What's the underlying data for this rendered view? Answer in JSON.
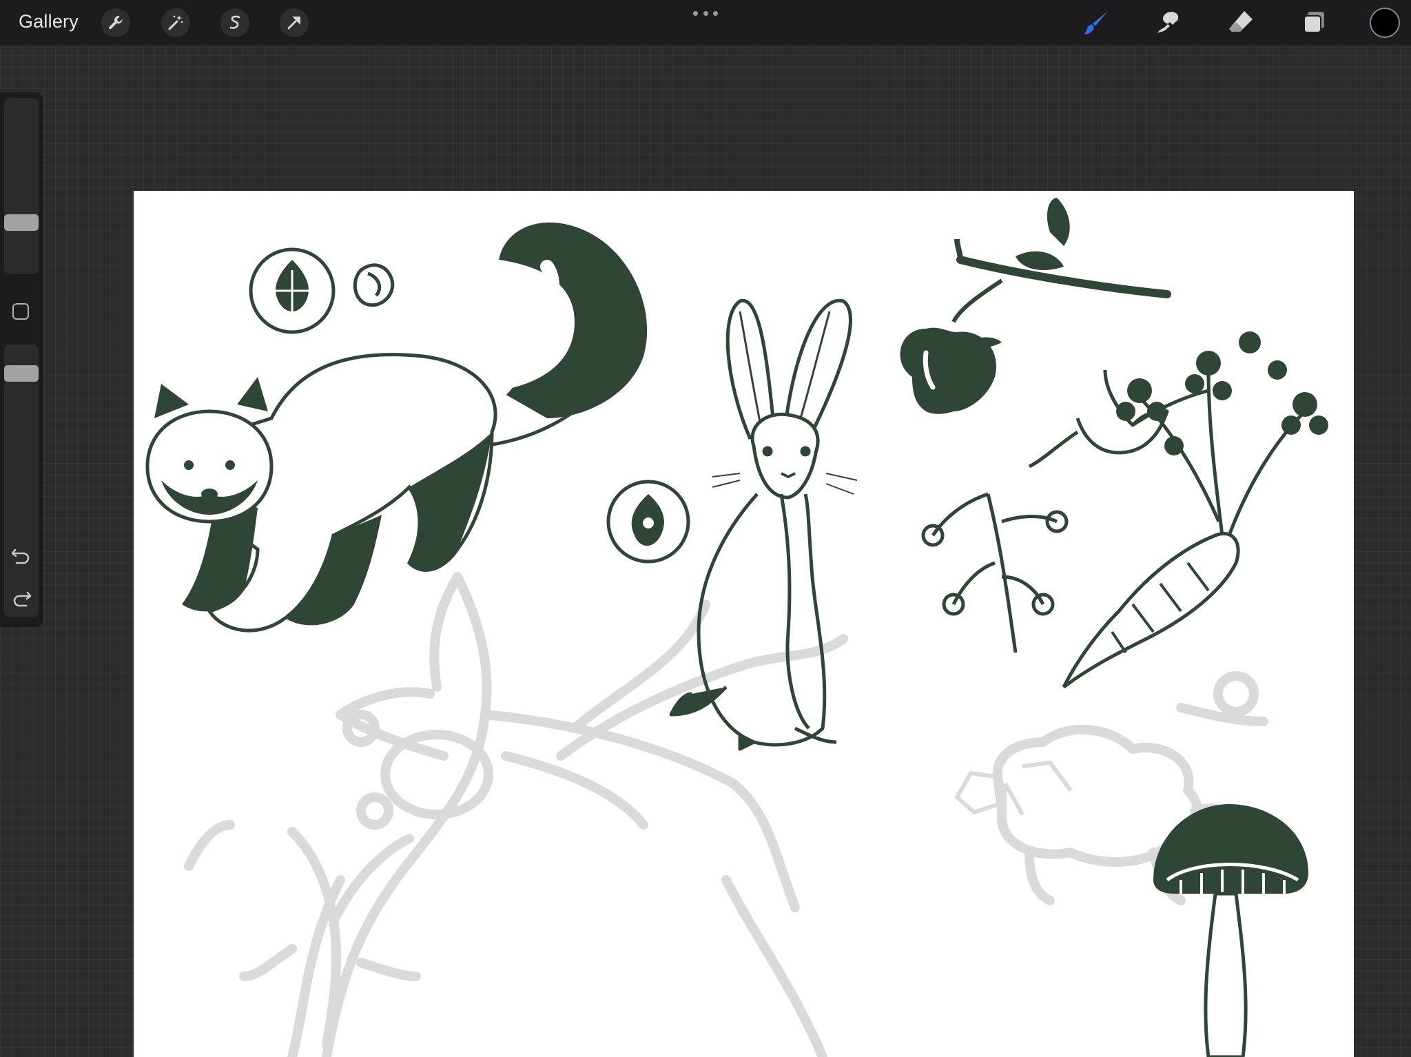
{
  "toolbar": {
    "gallery_label": "Gallery",
    "left_tools": [
      "wrench-icon",
      "magic-wand-icon",
      "selection-icon",
      "move-arrow-icon"
    ],
    "right_tools": [
      "brush-icon",
      "smudge-icon",
      "eraser-icon",
      "layers-icon"
    ],
    "active_tool": "brush",
    "active_tool_color": "#2f6fe8",
    "current_color": "#000000"
  },
  "sidebar": {
    "brush_size_level": 0.27,
    "opacity_level": 0.08,
    "icons": [
      "modify-square-icon",
      "undo-icon",
      "redo-icon"
    ]
  },
  "canvas": {
    "background": "#ffffff",
    "ink_color": "#2f4535",
    "sketch_color": "#d9d9d9"
  }
}
